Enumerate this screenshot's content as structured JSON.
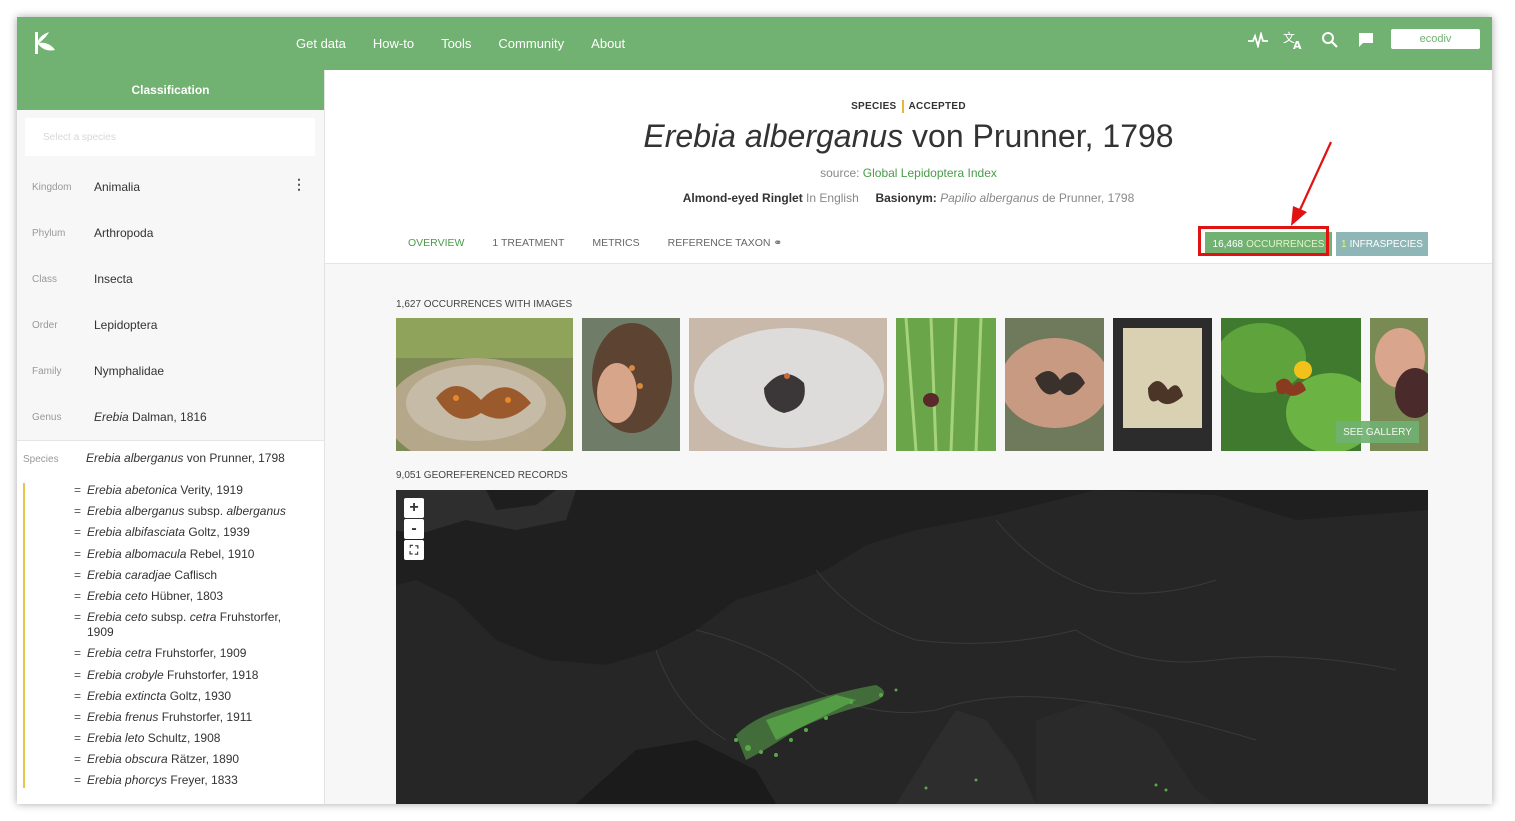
{
  "nav": {
    "items": [
      "Get data",
      "How-to",
      "Tools",
      "Community",
      "About"
    ],
    "user": "ecodiv"
  },
  "sidebar": {
    "title": "Classification",
    "search_placeholder": "Select a species",
    "ranks": [
      {
        "rank": "Kingdom",
        "value": "Animalia"
      },
      {
        "rank": "Phylum",
        "value": "Arthropoda"
      },
      {
        "rank": "Class",
        "value": "Insecta"
      },
      {
        "rank": "Order",
        "value": "Lepidoptera"
      },
      {
        "rank": "Family",
        "value": "Nymphalidae"
      },
      {
        "rank": "Genus",
        "value_italic": "Erebia",
        "value_rest": " Dalman, 1816"
      }
    ],
    "species": {
      "rank": "Species",
      "value_italic": "Erebia alberganus",
      "value_rest": " von Prunner, 1798"
    },
    "synonyms": [
      {
        "italic": "Erebia abetonica",
        "rest": " Verity, 1919"
      },
      {
        "italic": "Erebia alberganus",
        "rest": " subsp. ",
        "italic2": "alberganus"
      },
      {
        "italic": "Erebia albifasciata",
        "rest": " Goltz, 1939"
      },
      {
        "italic": "Erebia albomacula",
        "rest": " Rebel, 1910"
      },
      {
        "italic": "Erebia caradjae",
        "rest": " Caflisch"
      },
      {
        "italic": "Erebia ceto",
        "rest": " Hübner, 1803"
      },
      {
        "italic": "Erebia ceto",
        "rest": " subsp. ",
        "italic2": "cetra",
        "rest2": " Fruhstorfer, 1909"
      },
      {
        "italic": "Erebia cetra",
        "rest": " Fruhstorfer, 1909"
      },
      {
        "italic": "Erebia crobyle",
        "rest": " Fruhstorfer, 1918"
      },
      {
        "italic": "Erebia extincta",
        "rest": " Goltz, 1930"
      },
      {
        "italic": "Erebia frenus",
        "rest": " Fruhstorfer, 1911"
      },
      {
        "italic": "Erebia leto",
        "rest": " Schultz, 1908"
      },
      {
        "italic": "Erebia obscura",
        "rest": " Rätzer, 1890"
      },
      {
        "italic": "Erebia phorcys",
        "rest": " Freyer, 1833"
      }
    ]
  },
  "header": {
    "rank_label": "SPECIES",
    "status_label": "ACCEPTED",
    "title_italic": "Erebia alberganus",
    "title_rest": " von Prunner, 1798",
    "source_prefix": "source: ",
    "source_link": "Global Lepidoptera Index",
    "common_name": "Almond-eyed Ringlet",
    "common_lang": " In English",
    "basionym_label": "Basionym:",
    "basionym_italic": " Papilio alberganus",
    "basionym_rest": " de Prunner, 1798"
  },
  "tabs": [
    "OVERVIEW",
    "1 TREATMENT",
    "METRICS",
    "REFERENCE TAXON ⚭"
  ],
  "buttons": {
    "occ_count": "16,468",
    "occ_label": "OCCURRENCES",
    "infra_count": "1",
    "infra_label": "INFRASPECIES",
    "see_gallery": "SEE GALLERY"
  },
  "sections": {
    "images_label": "1,627 OCCURRENCES WITH IMAGES",
    "map_label": "9,051 GEOREFERENCED RECORDS"
  },
  "map_controls": {
    "zoom_in": "+",
    "zoom_out": "-",
    "fullscreen": "⛶"
  },
  "colors": {
    "brand": "#71b171",
    "highlight": "#e11212",
    "accent_bar": "#e8b63b"
  }
}
